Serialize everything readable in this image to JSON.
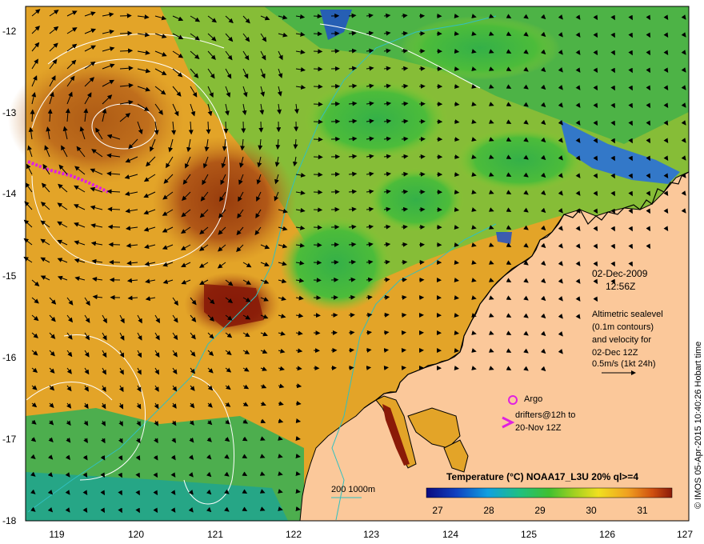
{
  "map": {
    "y_ticks": [
      "-12",
      "-13",
      "-14",
      "-15",
      "-16",
      "-17",
      "-18"
    ],
    "x_ticks": [
      "119",
      "120",
      "121",
      "122",
      "123",
      "124",
      "125",
      "126",
      "127"
    ],
    "date": "02-Dec-2009",
    "time": "12:56Z",
    "altimetry_lines": [
      "Altimetric sealevel",
      "(0.1m contours)",
      "and velocity for",
      "02-Dec 12Z",
      "0.5m/s (1kt 24h)"
    ],
    "legend_argo": "Argo",
    "legend_drifters_lines": [
      "drifters@12h to",
      "20-Nov 12Z"
    ],
    "colorbar_title": "Temperature (°C) NOAA17_L3U 20% ql>=4",
    "colorbar_ticks": [
      "27",
      "28",
      "29",
      "30",
      "31"
    ],
    "isobath_label": "200  1000m",
    "credit": "© IMOS 05-Apr-2015 10:40:26 Hobart time",
    "colors": {
      "land": "#fbc89a",
      "ocean_warm": "#e0a020",
      "ocean_hot": "#9c3a0c",
      "ocean_cool": "#3caa40",
      "ocean_cold": "#2060d0",
      "argo": "#e020e0",
      "isobath": "#30c0c0"
    }
  }
}
